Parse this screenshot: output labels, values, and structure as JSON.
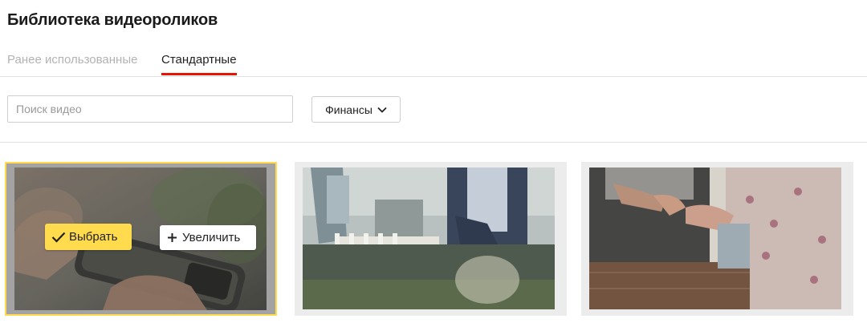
{
  "page": {
    "title": "Библиотека видеороликов"
  },
  "tabs": [
    {
      "label": "Ранее использованные",
      "active": false
    },
    {
      "label": "Стандартные",
      "active": true
    }
  ],
  "search": {
    "placeholder": "Поиск видео",
    "value": ""
  },
  "category_dropdown": {
    "selected": "Финансы",
    "icon": "chevron-down-icon"
  },
  "videos": [
    {
      "scene": "payment-terminal",
      "selected": true
    },
    {
      "scene": "office-meeting",
      "selected": false
    },
    {
      "scene": "card-payment",
      "selected": false
    }
  ],
  "overlay": {
    "select_label": "Выбрать",
    "select_icon": "check-icon",
    "zoom_label": "Увеличить",
    "zoom_icon": "plus-icon"
  },
  "colors": {
    "accent_yellow": "#ffdb4d",
    "tab_underline": "#e61400",
    "selected_border": "#ffdb4d"
  }
}
